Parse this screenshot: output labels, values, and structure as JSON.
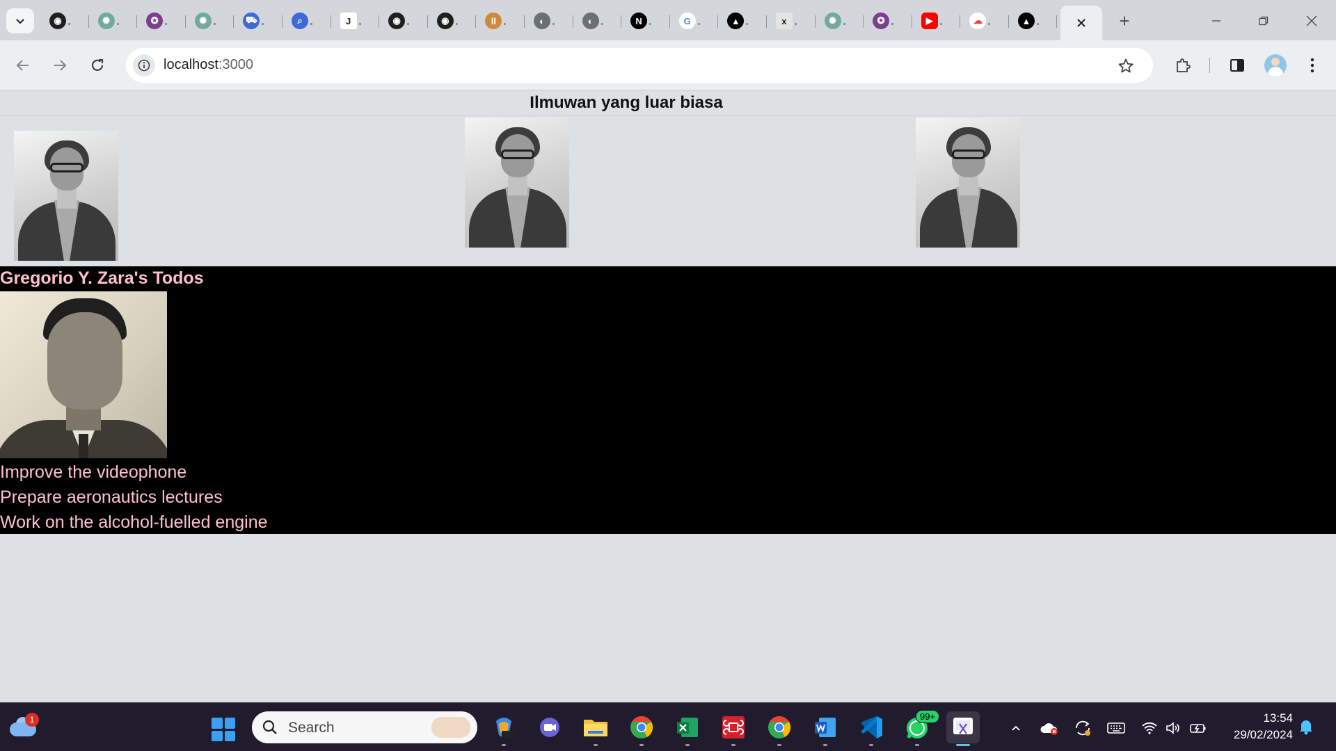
{
  "browser": {
    "tabs": [
      {
        "icon": "github-icon"
      },
      {
        "icon": "chatgpt-icon"
      },
      {
        "icon": "university-logo-icon"
      },
      {
        "icon": "chatgpt-icon"
      },
      {
        "icon": "cart-icon"
      },
      {
        "icon": "search-app-icon"
      },
      {
        "icon": "j-letter-icon",
        "glyph": "J"
      },
      {
        "icon": "github-icon"
      },
      {
        "icon": "github-icon"
      },
      {
        "icon": "brand-icon"
      },
      {
        "icon": "globe-icon"
      },
      {
        "icon": "globe-icon"
      },
      {
        "icon": "nextjs-icon",
        "glyph": "N"
      },
      {
        "icon": "google-icon",
        "glyph": "G"
      },
      {
        "icon": "vercel-icon"
      },
      {
        "icon": "x-letter-icon",
        "glyph": "x"
      },
      {
        "icon": "chatgpt-icon"
      },
      {
        "icon": "university-logo-icon"
      },
      {
        "icon": "youtube-icon"
      },
      {
        "icon": "google-cloud-icon"
      },
      {
        "icon": "vercel-icon"
      }
    ],
    "address": {
      "host": "localhost",
      "port": ":3000"
    }
  },
  "page": {
    "heading": "Ilmuwan yang luar biasa",
    "gallery": [
      {
        "alt": "portrait-1"
      },
      {
        "alt": "portrait-2"
      },
      {
        "alt": "portrait-3"
      }
    ],
    "todo": {
      "title": "Gregorio Y. Zara's Todos",
      "items": [
        "Improve the videophone",
        "Prepare aeronautics lectures",
        "Work on the alcohol-fuelled engine"
      ]
    }
  },
  "taskbar": {
    "weather_badge": "1",
    "search_placeholder": "Search",
    "whatsapp_badge": "99+",
    "time": "13:54",
    "date": "29/02/2024"
  },
  "colors": {
    "todo_text": "#ffc0cb",
    "todo_bg": "#000000",
    "page_bg": "#dde1e3"
  }
}
